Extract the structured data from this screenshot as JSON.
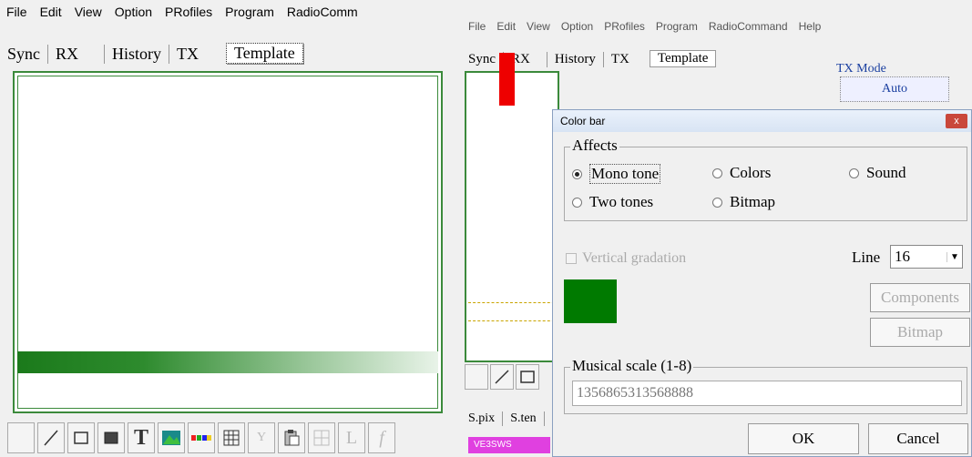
{
  "left": {
    "menu": [
      "File",
      "Edit",
      "View",
      "Option",
      "PRofiles",
      "Program",
      "RadioComm"
    ],
    "tabs": [
      "Sync",
      "RX",
      "History",
      "TX",
      "Template"
    ],
    "selected_tab": "Template",
    "toolbar_icons": [
      "blank-icon",
      "line-icon",
      "rectangle-icon",
      "filled-rectangle-icon",
      "text-icon",
      "image-icon",
      "color-bar-icon",
      "grid-icon",
      "vector-icon",
      "paste-icon",
      "table-icon",
      "L",
      "f"
    ],
    "toolbar_texts": {
      "text": "T",
      "y": "Y",
      "l": "L",
      "f": "f"
    }
  },
  "right": {
    "menu": [
      "File",
      "Edit",
      "View",
      "Option",
      "PRofiles",
      "Program",
      "RadioCommand",
      "Help"
    ],
    "tabs": [
      "Sync",
      "RX",
      "History",
      "TX",
      "Template"
    ],
    "tx_mode": {
      "label": "TX Mode",
      "value": "Auto"
    },
    "bottom_tabs": [
      "S.pix",
      "S.ten"
    ],
    "badge": "VE3SWS"
  },
  "dialog": {
    "title": "Color bar",
    "close": "x",
    "affects": {
      "legend": "Affects",
      "options": [
        "Mono tone",
        "Colors",
        "Sound",
        "Two tones",
        "Bitmap"
      ],
      "selected": "Mono tone"
    },
    "vertical_gradation": {
      "label": "Vertical gradation",
      "checked": false,
      "enabled": false
    },
    "line": {
      "label": "Line",
      "value": "16"
    },
    "swatch_color": "#007a00",
    "components_label": "Components",
    "bitmap_label": "Bitmap",
    "musical_scale": {
      "legend": "Musical scale (1-8)",
      "value": "1356865313568888"
    },
    "ok_label": "OK",
    "cancel_label": "Cancel"
  }
}
